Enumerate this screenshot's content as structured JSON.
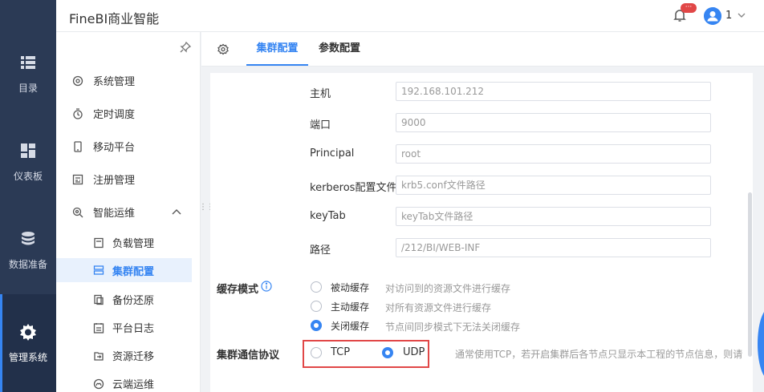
{
  "app_title": "FineBI商业智能",
  "header": {
    "badge": "···",
    "user": "1"
  },
  "rail": [
    {
      "label": "目录",
      "icon": "list-icon"
    },
    {
      "label": "仪表板",
      "icon": "dashboard-icon"
    },
    {
      "label": "数据准备",
      "icon": "database-icon"
    },
    {
      "label": "管理系统",
      "icon": "gear-icon",
      "active": true
    }
  ],
  "subnav": {
    "items": [
      {
        "label": "系统管理",
        "icon": "settings-icon"
      },
      {
        "label": "定时调度",
        "icon": "timer-icon"
      },
      {
        "label": "移动平台",
        "icon": "mobile-icon"
      },
      {
        "label": "注册管理",
        "icon": "register-icon"
      },
      {
        "label": "智能运维",
        "icon": "ops-icon",
        "expanded": true
      }
    ],
    "children": [
      {
        "label": "负载管理",
        "icon": "load-icon"
      },
      {
        "label": "集群配置",
        "icon": "cluster-icon",
        "active": true
      },
      {
        "label": "备份还原",
        "icon": "backup-icon"
      },
      {
        "label": "平台日志",
        "icon": "log-icon"
      },
      {
        "label": "资源迁移",
        "icon": "migrate-icon"
      },
      {
        "label": "云端运维",
        "icon": "cloud-icon"
      }
    ]
  },
  "tabs": [
    {
      "label": "集群配置",
      "active": true
    },
    {
      "label": "参数配置",
      "active": false
    }
  ],
  "form": {
    "host": {
      "label": "主机",
      "value": "192.168.101.212"
    },
    "port": {
      "label": "端口",
      "value": "9000"
    },
    "principal": {
      "label": "Principal",
      "value": "root"
    },
    "kerberos": {
      "label": "kerberos配置文件",
      "value": "krb5.conf文件路径"
    },
    "keytab": {
      "label": "keyTab",
      "value": "keyTab文件路径"
    },
    "path": {
      "label": "路径",
      "value": "/212/BI/WEB-INF"
    }
  },
  "cache": {
    "label": "缓存模式",
    "options": [
      {
        "label": "被动缓存",
        "desc": "对访问到的资源文件进行缓存",
        "selected": false
      },
      {
        "label": "主动缓存",
        "desc": "对所有资源文件进行缓存",
        "selected": false
      },
      {
        "label": "关闭缓存",
        "desc": "节点间同步模式下无法关闭缓存",
        "selected": true
      }
    ]
  },
  "protocol": {
    "label": "集群通信协议",
    "options": [
      {
        "label": "TCP",
        "selected": false
      },
      {
        "label": "UDP",
        "selected": true
      }
    ],
    "desc": "通常使用TCP，若开启集群后各节点只显示本工程的节点信息，则请"
  },
  "colors": {
    "accent": "#3685f2",
    "rail": "#2b3a55",
    "highlight": "#e14747"
  }
}
